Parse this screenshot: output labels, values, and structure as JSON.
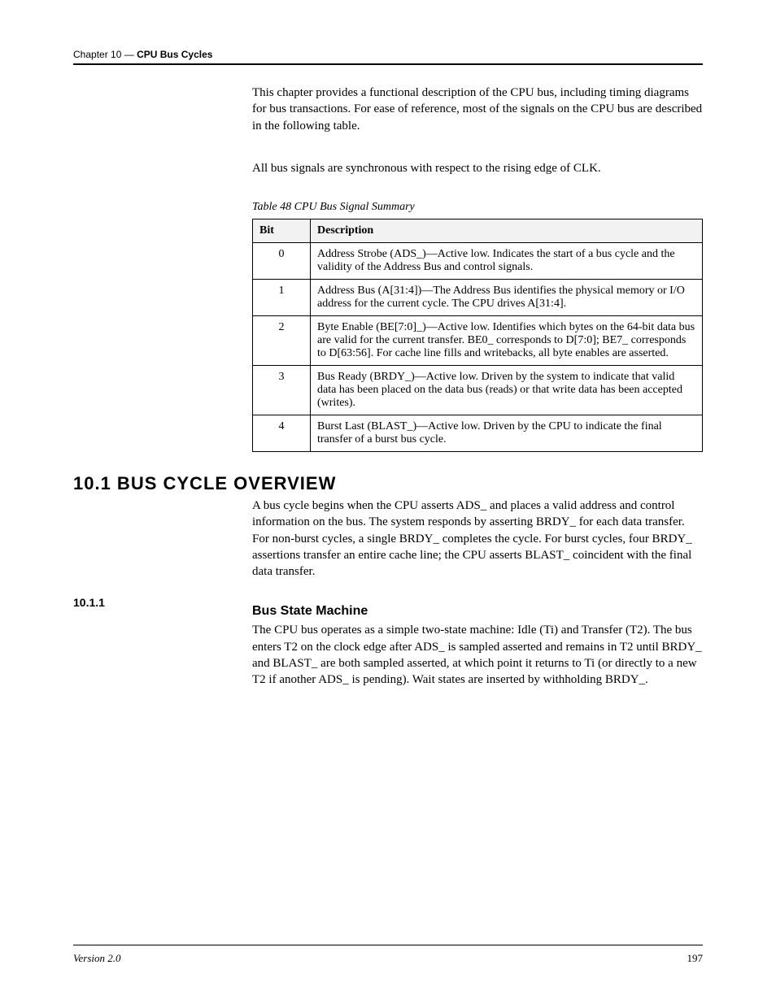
{
  "header": {
    "chapter": "Chapter 10",
    "chapter_title": "CPU Bus Cycles"
  },
  "rows": [
    {
      "side": "",
      "paras": [
        "This chapter provides a functional description of the CPU bus, including timing diagrams for bus transactions. For ease of reference, most of the signals on the CPU bus are described in the following table."
      ]
    },
    {
      "side": "",
      "paras": [
        "All bus signals are synchronous with respect to the rising edge of CLK."
      ]
    }
  ],
  "table": {
    "caption": "Table 48 CPU Bus Signal Summary",
    "headers": [
      "Bit",
      "Description"
    ],
    "data": [
      {
        "bit": "0",
        "desc": "Address Strobe (ADS_)—Active low. Indicates the start of a bus cycle and the validity of the Address Bus and control signals."
      },
      {
        "bit": "1",
        "desc": "Address Bus (A[31:4])—The Address Bus identifies the physical memory or I/O address for the current cycle. The CPU drives A[31:4]."
      },
      {
        "bit": "2",
        "desc": "Byte Enable (BE[7:0]_)—Active low. Identifies which bytes on the 64-bit data bus are valid for the current transfer. BE0_ corresponds to D[7:0]; BE7_ corresponds to D[63:56]. For cache line fills and writebacks, all byte enables are asserted."
      },
      {
        "bit": "3",
        "desc": "Bus Ready (BRDY_)—Active low. Driven by the system to indicate that valid data has been placed on the data bus (reads) or that write data has been accepted (writes)."
      },
      {
        "bit": "4",
        "desc": "Burst Last (BLAST_)—Active low. Driven by the CPU to indicate the final transfer of a burst bus cycle."
      }
    ]
  },
  "section": {
    "heading": "10.1 BUS CYCLE OVERVIEW",
    "body": "A bus cycle begins when the CPU asserts ADS_ and places a valid address and control information on the bus. The system responds by asserting BRDY_ for each data transfer. For non-burst cycles, a single BRDY_ completes the cycle. For burst cycles, four BRDY_ assertions transfer an entire cache line; the CPU asserts BLAST_ coincident with the final data transfer."
  },
  "subsection": {
    "side": "10.1.1",
    "heading": "Bus State Machine",
    "body": "The CPU bus operates as a simple two-state machine: Idle (Ti) and Transfer (T2). The bus enters T2 on the clock edge after ADS_ is sampled asserted and remains in T2 until BRDY_ and BLAST_ are both sampled asserted, at which point it returns to Ti (or directly to a new T2 if another ADS_ is pending). Wait states are inserted by withholding BRDY_."
  },
  "footer": {
    "version": "Version 2.0",
    "page": "197"
  }
}
